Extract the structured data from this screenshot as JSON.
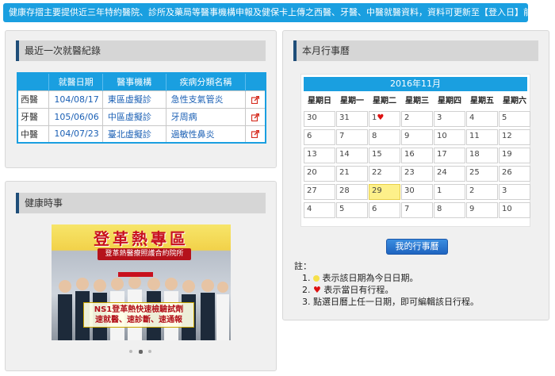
{
  "notice": "健康存摺主要提供近三年特約醫院、診所及藥局等醫事機構申報及健保卡上傳之西醫、牙醫、中醫就醫資料，資料可更新至【登入日】前二日。",
  "visits": {
    "title": "最近一次就醫紀錄",
    "headers": [
      "",
      "就醫日期",
      "醫事機構",
      "疾病分類名稱",
      ""
    ],
    "rows": [
      {
        "kind": "西醫",
        "date": "104/08/17",
        "org": "東區虛擬診",
        "disease": "急性支氣管炎",
        "link_icon": "external-link-icon"
      },
      {
        "kind": "牙醫",
        "date": "105/06/06",
        "org": "中區虛擬診",
        "disease": "牙周病",
        "link_icon": "external-link-icon"
      },
      {
        "kind": "中醫",
        "date": "104/07/23",
        "org": "臺北虛擬診",
        "disease": "過敏性鼻炎",
        "link_icon": "external-link-icon"
      }
    ]
  },
  "news": {
    "title": "健康時事",
    "banner": {
      "headline": "登革熱專區",
      "subline": "登革熱醫療照護合約院所",
      "caption_line1": "NS1登革熱快速檢驗試劑",
      "caption_line2": "速就醫、速診斷、速通報"
    },
    "carousel_dots": 3,
    "active_dot": 1
  },
  "calendar": {
    "title": "本月行事曆",
    "month_label": "2016年11月",
    "weekdays": [
      "星期日",
      "星期一",
      "星期二",
      "星期三",
      "星期四",
      "星期五",
      "星期六"
    ],
    "weeks": [
      [
        "30",
        "31",
        "1",
        "2",
        "3",
        "4",
        "5"
      ],
      [
        "6",
        "7",
        "8",
        "9",
        "10",
        "11",
        "12"
      ],
      [
        "13",
        "14",
        "15",
        "16",
        "17",
        "18",
        "19"
      ],
      [
        "20",
        "21",
        "22",
        "23",
        "24",
        "25",
        "26"
      ],
      [
        "27",
        "28",
        "29",
        "30",
        "1",
        "2",
        "3"
      ],
      [
        "4",
        "5",
        "6",
        "7",
        "8",
        "9",
        "10"
      ]
    ],
    "today": {
      "week": 4,
      "day": 2
    },
    "event_day": {
      "week": 0,
      "day": 2
    },
    "my_calendar_button": "我的行事曆",
    "note_title": "註：",
    "notes": [
      "表示該日期為今日日期。",
      "表示當日有行程。",
      "點選日曆上任一日期，即可編輯該日行程。"
    ],
    "colors": {
      "today": "#fdf08a",
      "event": "#d11111",
      "header": "#1a9fe0"
    }
  }
}
